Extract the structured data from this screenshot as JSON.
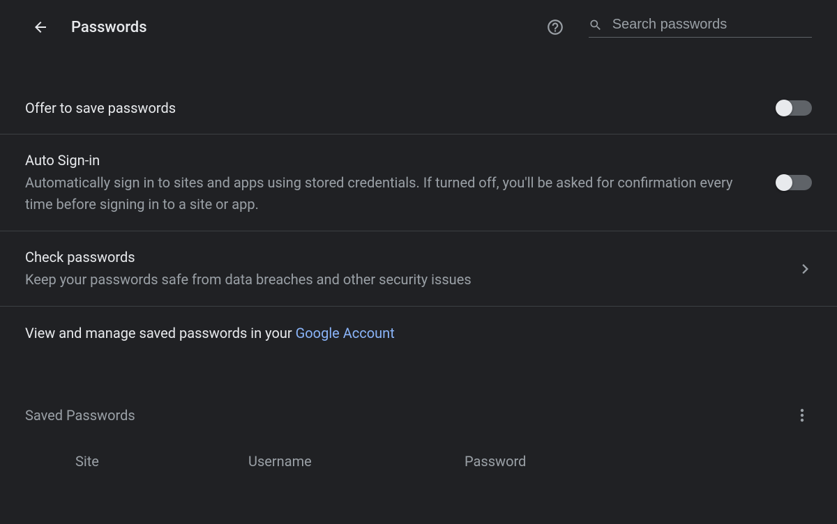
{
  "header": {
    "title": "Passwords",
    "search_placeholder": "Search passwords"
  },
  "settings": {
    "offer_save": {
      "title": "Offer to save passwords"
    },
    "auto_signin": {
      "title": "Auto Sign-in",
      "desc": "Automatically sign in to sites and apps using stored credentials. If turned off, you'll be asked for confirmation every time before signing in to a site or app."
    },
    "check": {
      "title": "Check passwords",
      "desc": "Keep your passwords safe from data breaches and other security issues"
    }
  },
  "manage": {
    "prefix": "View and manage saved passwords in your ",
    "link": "Google Account"
  },
  "saved": {
    "heading": "Saved Passwords",
    "columns": {
      "site": "Site",
      "username": "Username",
      "password": "Password"
    }
  }
}
